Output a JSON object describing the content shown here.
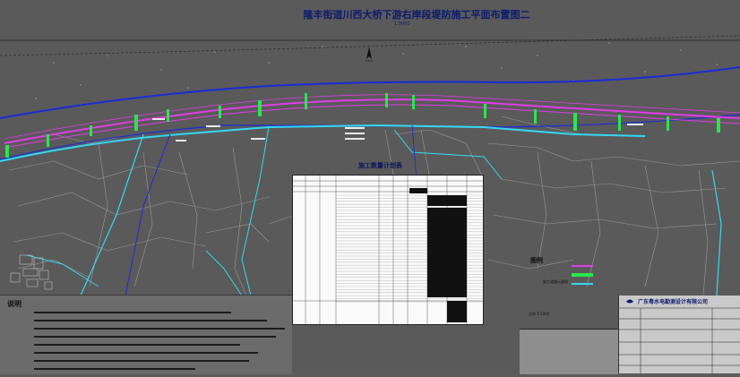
{
  "title": "隆丰街道川西大桥下游右岸段堤防施工平面布置图二",
  "scale_ratio": "1:5000",
  "stats_table_title": "施工数量计划表",
  "notes_title": "说明",
  "legend_title": "图例",
  "legend_items": [
    "",
    "",
    "施工道路示意图"
  ],
  "company": "广东粤水电勘测设计有限公司",
  "drawing_scale": "比例 1:1000",
  "colors": {
    "river_boundary": "#1a2bd6",
    "embankment": "#e13ce8",
    "construction_section": "#27e84a",
    "road": "#34d8f5",
    "ground": "#5a5a5a"
  },
  "icons": [
    "north-arrow-icon",
    "company-logo-icon"
  ]
}
